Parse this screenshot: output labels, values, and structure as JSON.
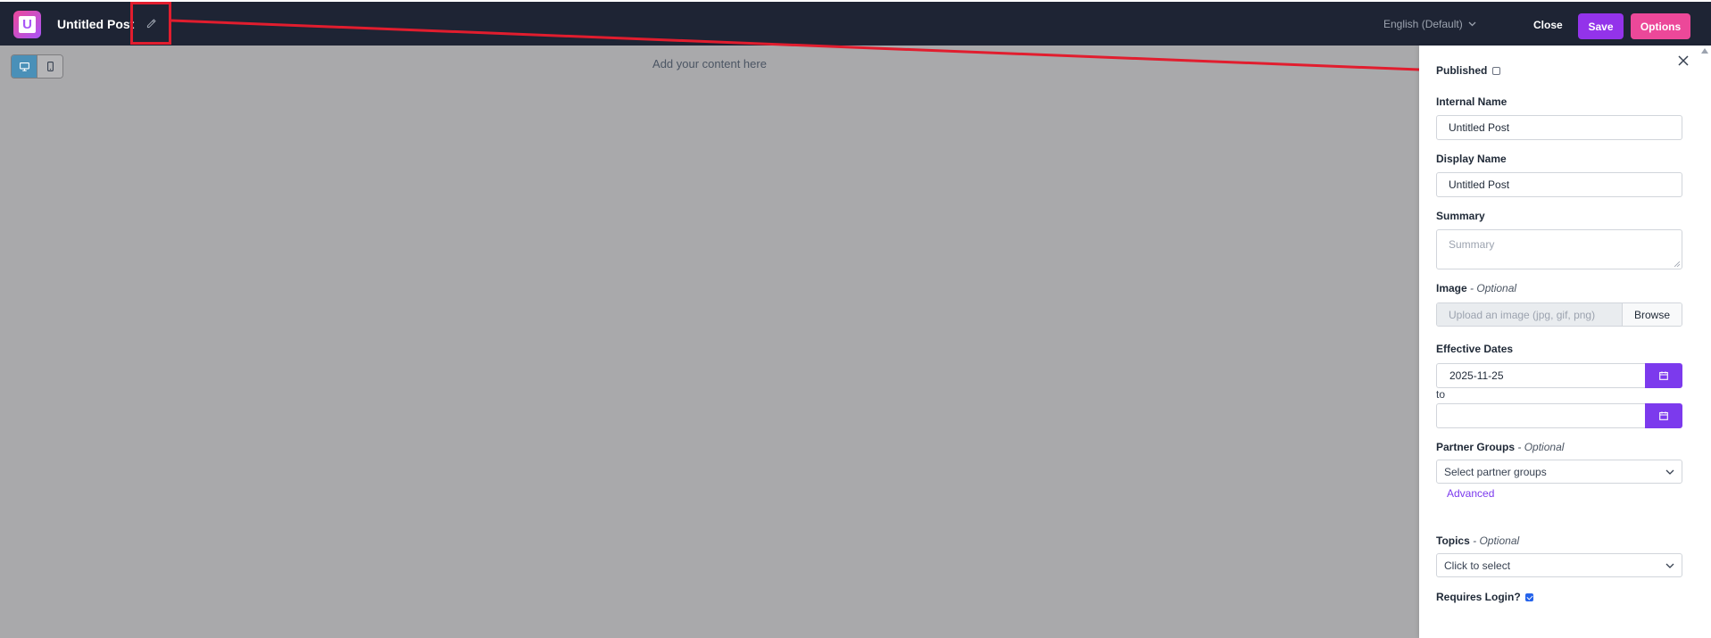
{
  "header": {
    "title": "Untitled Post",
    "language": "English (Default)",
    "close_label": "Close",
    "save_label": "Save",
    "options_label": "Options"
  },
  "canvas": {
    "hint": "Add your content here",
    "devices": [
      "desktop-icon",
      "mobile-icon"
    ],
    "active_device": "desktop"
  },
  "panel": {
    "published_label": "Published",
    "published_checked": false,
    "internal_name_label": "Internal Name",
    "internal_name_value": "Untitled Post",
    "display_name_label": "Display Name",
    "display_name_value": "Untitled Post",
    "summary_label": "Summary",
    "summary_placeholder": "Summary",
    "image_label": "Image",
    "image_optional": "Optional",
    "image_placeholder": "Upload an image (jpg, gif, png)",
    "browse_label": "Browse",
    "effective_dates_label": "Effective Dates",
    "start_date": "2025-11-25",
    "to_label": "to",
    "end_date": "",
    "partner_groups_label": "Partner Groups",
    "partner_groups_optional": "Optional",
    "partner_groups_placeholder": "Select partner groups",
    "advanced_label": "Advanced",
    "topics_label": "Topics",
    "topics_optional": "Optional",
    "topics_placeholder": "Click to select",
    "requires_login_label": "Requires Login?",
    "requires_login_checked": true
  },
  "colors": {
    "topbar": "#1e2434",
    "save": "#9333ea",
    "options": "#ec4899",
    "accent": "#7c3aed",
    "canvas": "#a9a9ab",
    "highlight": "#e11d2e"
  }
}
